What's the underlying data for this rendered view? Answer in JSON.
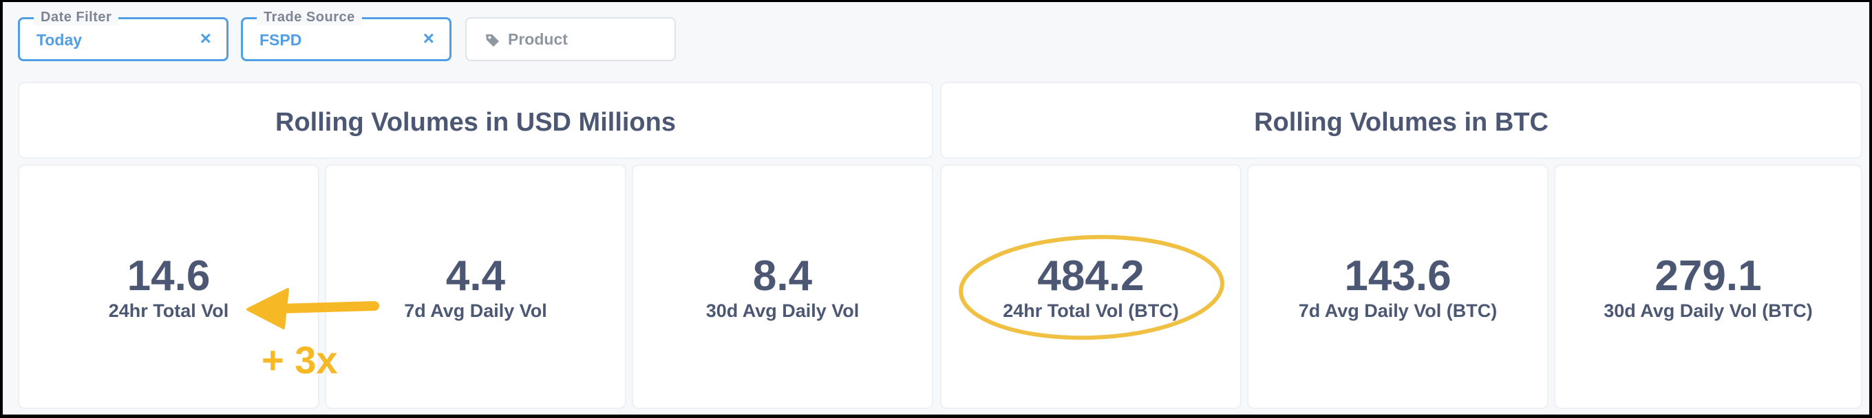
{
  "filters": [
    {
      "label": "Date Filter",
      "value": "Today",
      "close": "×"
    },
    {
      "label": "Trade Source",
      "value": "FSPD",
      "close": "×"
    },
    {
      "placeholder": "Product",
      "icon": "tag-icon"
    }
  ],
  "sections": {
    "usd": {
      "title": "Rolling Volumes in USD Millions"
    },
    "btc": {
      "title": "Rolling Volumes in BTC"
    }
  },
  "metrics": [
    {
      "value": "14.6",
      "label": "24hr Total Vol"
    },
    {
      "value": "4.4",
      "label": "7d Avg Daily Vol"
    },
    {
      "value": "8.4",
      "label": "30d Avg Daily Vol"
    },
    {
      "value": "484.2",
      "label": "24hr Total Vol (BTC)"
    },
    {
      "value": "143.6",
      "label": "7d Avg Daily Vol (BTC)"
    },
    {
      "value": "279.1",
      "label": "30d Avg Daily Vol (BTC)"
    }
  ],
  "annotations": {
    "multiplier_text": "+ 3x",
    "color": "#f6b825"
  },
  "colors": {
    "accent": "#509ee3",
    "text": "#4c5773",
    "muted": "#8e96a0"
  }
}
